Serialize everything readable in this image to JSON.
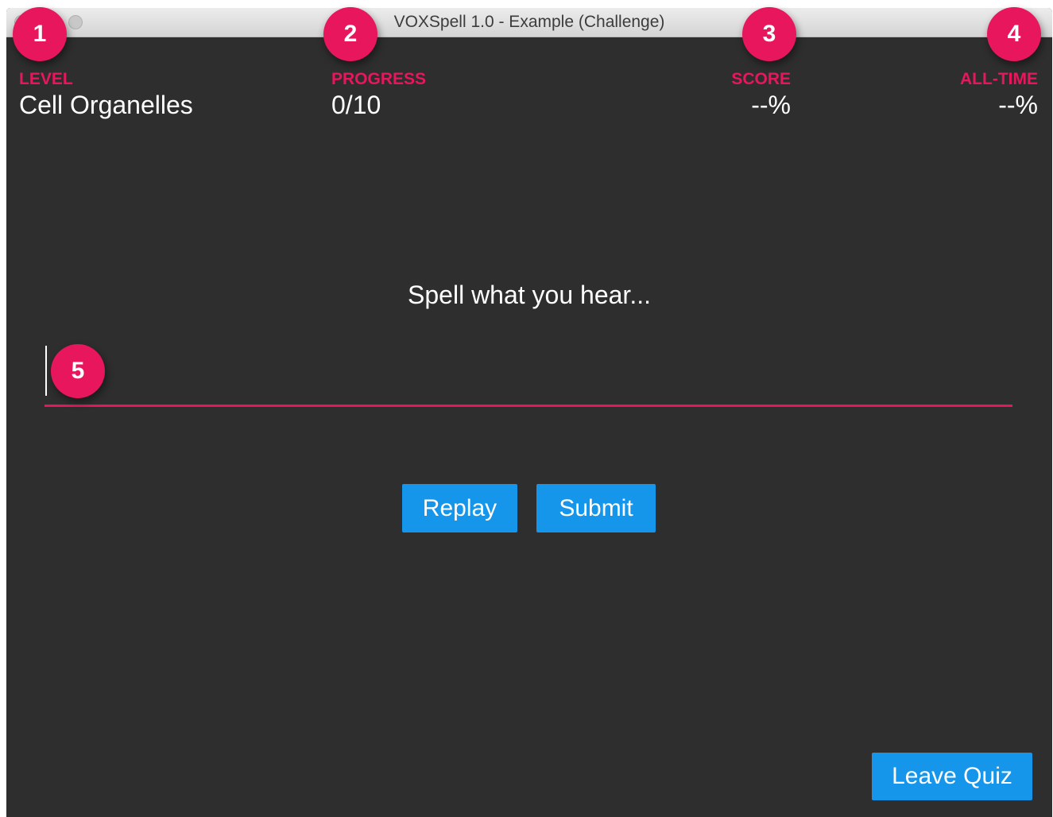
{
  "window": {
    "title": "VOXSpell 1.0 - Example (Challenge)"
  },
  "stats": {
    "level": {
      "label": "LEVEL",
      "value": "Cell Organelles"
    },
    "progress": {
      "label": "PROGRESS",
      "value": "0/10"
    },
    "score": {
      "label": "SCORE",
      "value": "--%"
    },
    "all_time": {
      "label": "ALL-TIME",
      "value": "--%"
    }
  },
  "quiz": {
    "prompt": "Spell what you hear...",
    "answer_value": "",
    "replay_label": "Replay",
    "submit_label": "Submit",
    "leave_label": "Leave Quiz"
  },
  "annotations": {
    "badge_1": "1",
    "badge_2": "2",
    "badge_3": "3",
    "badge_4": "4",
    "badge_5": "5"
  },
  "colors": {
    "background": "#2e2e2e",
    "accent": "#e8175d",
    "button": "#1596ea",
    "text": "#ffffff"
  }
}
